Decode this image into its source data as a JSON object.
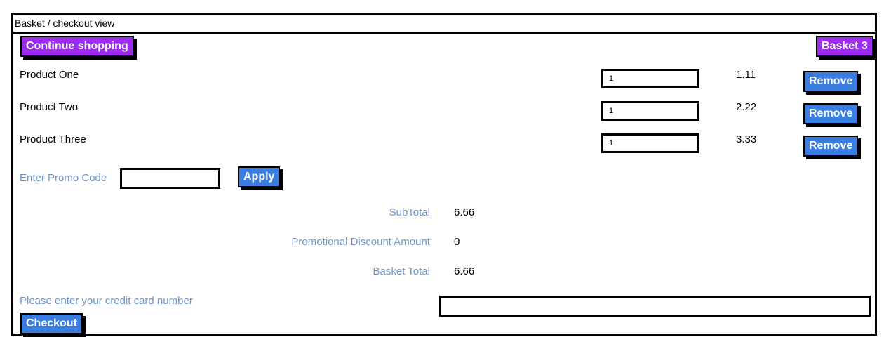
{
  "window": {
    "title": "Basket / checkout view"
  },
  "header": {
    "continue_label": "Continue shopping",
    "basket_label": "Basket 3"
  },
  "products": [
    {
      "name": "Product One",
      "quantity": "1",
      "price": "1.11",
      "remove_label": "Remove"
    },
    {
      "name": "Product Two",
      "quantity": "1",
      "price": "2.22",
      "remove_label": "Remove"
    },
    {
      "name": "Product Three",
      "quantity": "1",
      "price": "3.33",
      "remove_label": "Remove"
    }
  ],
  "promo": {
    "label": "Enter Promo Code",
    "value": "",
    "apply_label": "Apply"
  },
  "totals": {
    "subtotal_label": "SubTotal",
    "subtotal_value": "6.66",
    "discount_label": "Promotional Discount Amount",
    "discount_value": "0",
    "total_label": "Basket Total",
    "total_value": "6.66"
  },
  "payment": {
    "card_label": "Please enter your credit card number",
    "card_value": "",
    "checkout_label": "Checkout"
  },
  "colors": {
    "purple_button": "#9b2cf0",
    "blue_button": "#3a7de0",
    "label_blue": "#6b95c8"
  }
}
